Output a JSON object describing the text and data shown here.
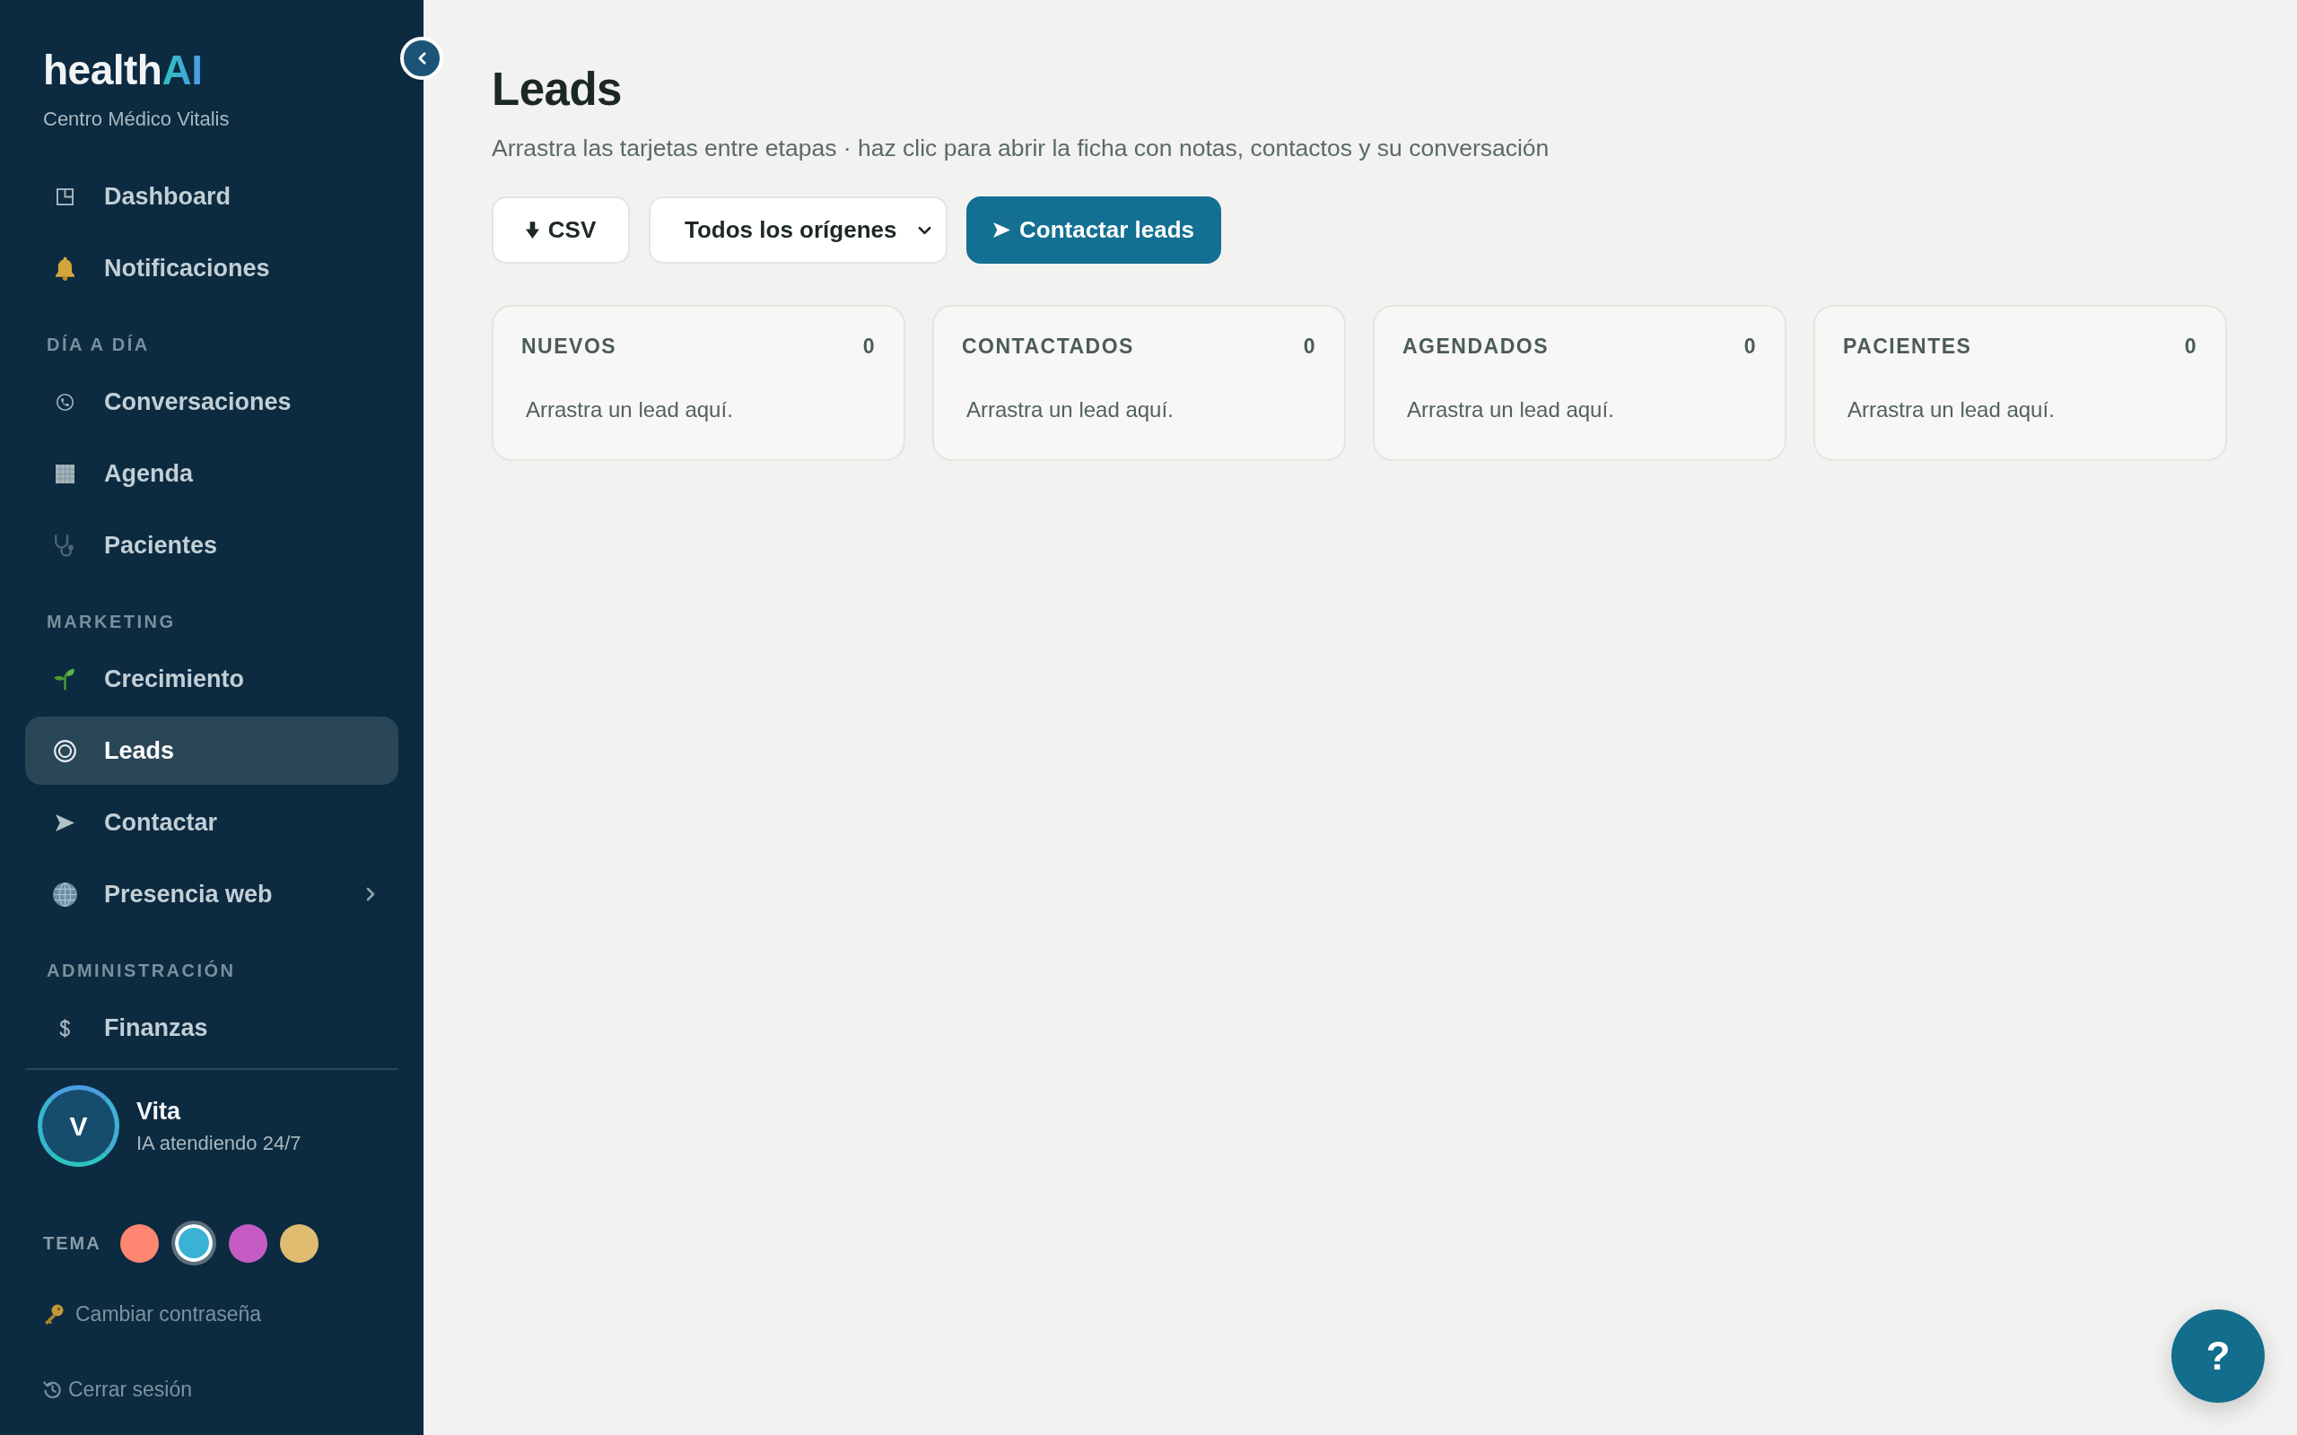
{
  "sidebar": {
    "logo": {
      "wordmark": "health",
      "accent": "AI"
    },
    "organization": "Centro Médico Vitalis",
    "sections": [
      {
        "items": [
          {
            "label": "Dashboard",
            "kind": "link",
            "selected": false
          },
          {
            "label": "Notificaciones",
            "kind": "link",
            "selected": false
          }
        ]
      },
      {
        "title": "DÍA A DÍA",
        "items": [
          {
            "label": "Conversaciones",
            "kind": "link",
            "selected": false
          },
          {
            "label": "Agenda",
            "kind": "link",
            "selected": false
          },
          {
            "label": "Pacientes",
            "kind": "link",
            "selected": false
          }
        ]
      },
      {
        "title": "MARKETING",
        "items": [
          {
            "label": "Crecimiento",
            "kind": "link",
            "selected": false
          },
          {
            "label": "Leads",
            "kind": "link",
            "selected": true
          },
          {
            "label": "Contactar",
            "kind": "link",
            "selected": false
          },
          {
            "label": "Presencia web",
            "kind": "group",
            "selected": false
          }
        ]
      },
      {
        "title": "ADMINISTRACIÓN",
        "items": [
          {
            "label": "Finanzas",
            "kind": "link",
            "selected": false
          }
        ]
      }
    ],
    "assistant": {
      "avatar_letter": "V",
      "name": "Vita",
      "status": "IA atendiendo 24/7"
    },
    "theme": {
      "label": "TEMA",
      "swatches": [
        {
          "color": "#ff8670",
          "selected": false
        },
        {
          "color": "#3ab2d6",
          "selected": true
        },
        {
          "color": "#c45cc4",
          "selected": false
        },
        {
          "color": "#dfbc70",
          "selected": false
        }
      ]
    },
    "links": [
      {
        "label": "Cambiar contraseña"
      },
      {
        "label": "Cerrar sesión"
      }
    ]
  },
  "page": {
    "title": "Leads",
    "subtitle": "Arrastra las tarjetas entre etapas · haz clic para abrir la ficha con notas, contactos y su conversación",
    "toolbar": {
      "export_button": "CSV",
      "source_filter": {
        "value": "Todos los orígenes"
      },
      "contact_button": "Contactar leads"
    },
    "stages": [
      {
        "title": "NUEVOS",
        "count": "0",
        "empty_text": "Arrastra un lead aquí."
      },
      {
        "title": "CONTACTADOS",
        "count": "0",
        "empty_text": "Arrastra un lead aquí."
      },
      {
        "title": "AGENDADOS",
        "count": "0",
        "empty_text": "Arrastra un lead aquí."
      },
      {
        "title": "PACIENTES",
        "count": "0",
        "empty_text": "Arrastra un lead aquí."
      }
    ]
  },
  "help_button": "?"
}
